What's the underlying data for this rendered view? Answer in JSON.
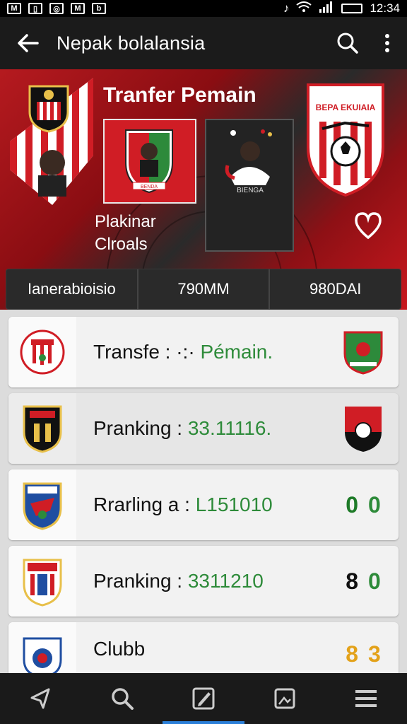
{
  "status": {
    "time": "12:34"
  },
  "appbar": {
    "title": "Nepak bolalansia"
  },
  "banner": {
    "title": "Tranfer Pemain",
    "sub1": "Plakinar",
    "sub2": "Clroals",
    "crest_right_text": "BEPA EKUIAIA",
    "card_red_text": "BENDA",
    "card_dark_text": "BIENGA"
  },
  "stats": [
    "Ianerabioisio",
    "790MM",
    "980DAI"
  ],
  "rows": [
    {
      "label": "Transfe : ·:· ",
      "value": "Pémain.",
      "right": ""
    },
    {
      "label": "Pranking : ",
      "value": "33.11116.",
      "right": ""
    },
    {
      "label": "Rrarling a : ",
      "value": "L151010",
      "right_a": "0",
      "right_b": "0"
    },
    {
      "label": "Pranking : ",
      "value": "3311210",
      "right_a": "8",
      "right_b": "0"
    },
    {
      "label": "Clubb",
      "value": "",
      "right_a": "8",
      "right_b": "3"
    }
  ],
  "colors": {
    "accent": "#c8171d",
    "green": "#2e8b3a",
    "active_tab": "#2b7fd8"
  }
}
